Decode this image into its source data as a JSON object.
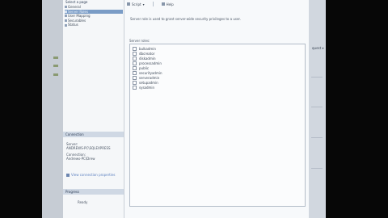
{
  "window": {
    "pane_title": "Select a page"
  },
  "pages": [
    {
      "label": "General",
      "selected": false
    },
    {
      "label": "Server Roles",
      "selected": true
    },
    {
      "label": "User Mapping",
      "selected": false
    },
    {
      "label": "Securables",
      "selected": false
    },
    {
      "label": "Status",
      "selected": false
    }
  ],
  "connection": {
    "header": "Connection",
    "server_label": "Server:",
    "server_value": "ANDREWS-PC\\SQLEXPRESS",
    "connection_label": "Connection:",
    "connection_value": "Andrews-PC\\Drew",
    "view_link": "View connection properties"
  },
  "progress": {
    "header": "Progress",
    "status": "Ready"
  },
  "toolbar": {
    "script_label": "Script",
    "help_label": "Help"
  },
  "main": {
    "description": "Server role is used to grant server-wide security privileges to a user.",
    "roles_label": "Server roles:",
    "roles": [
      "bulkadmin",
      "dbcreator",
      "diskadmin",
      "processadmin",
      "public",
      "securityadmin",
      "serveradmin",
      "setupadmin",
      "sysadmin"
    ]
  },
  "background_app": {
    "dropdown_text": "quest ▾"
  }
}
